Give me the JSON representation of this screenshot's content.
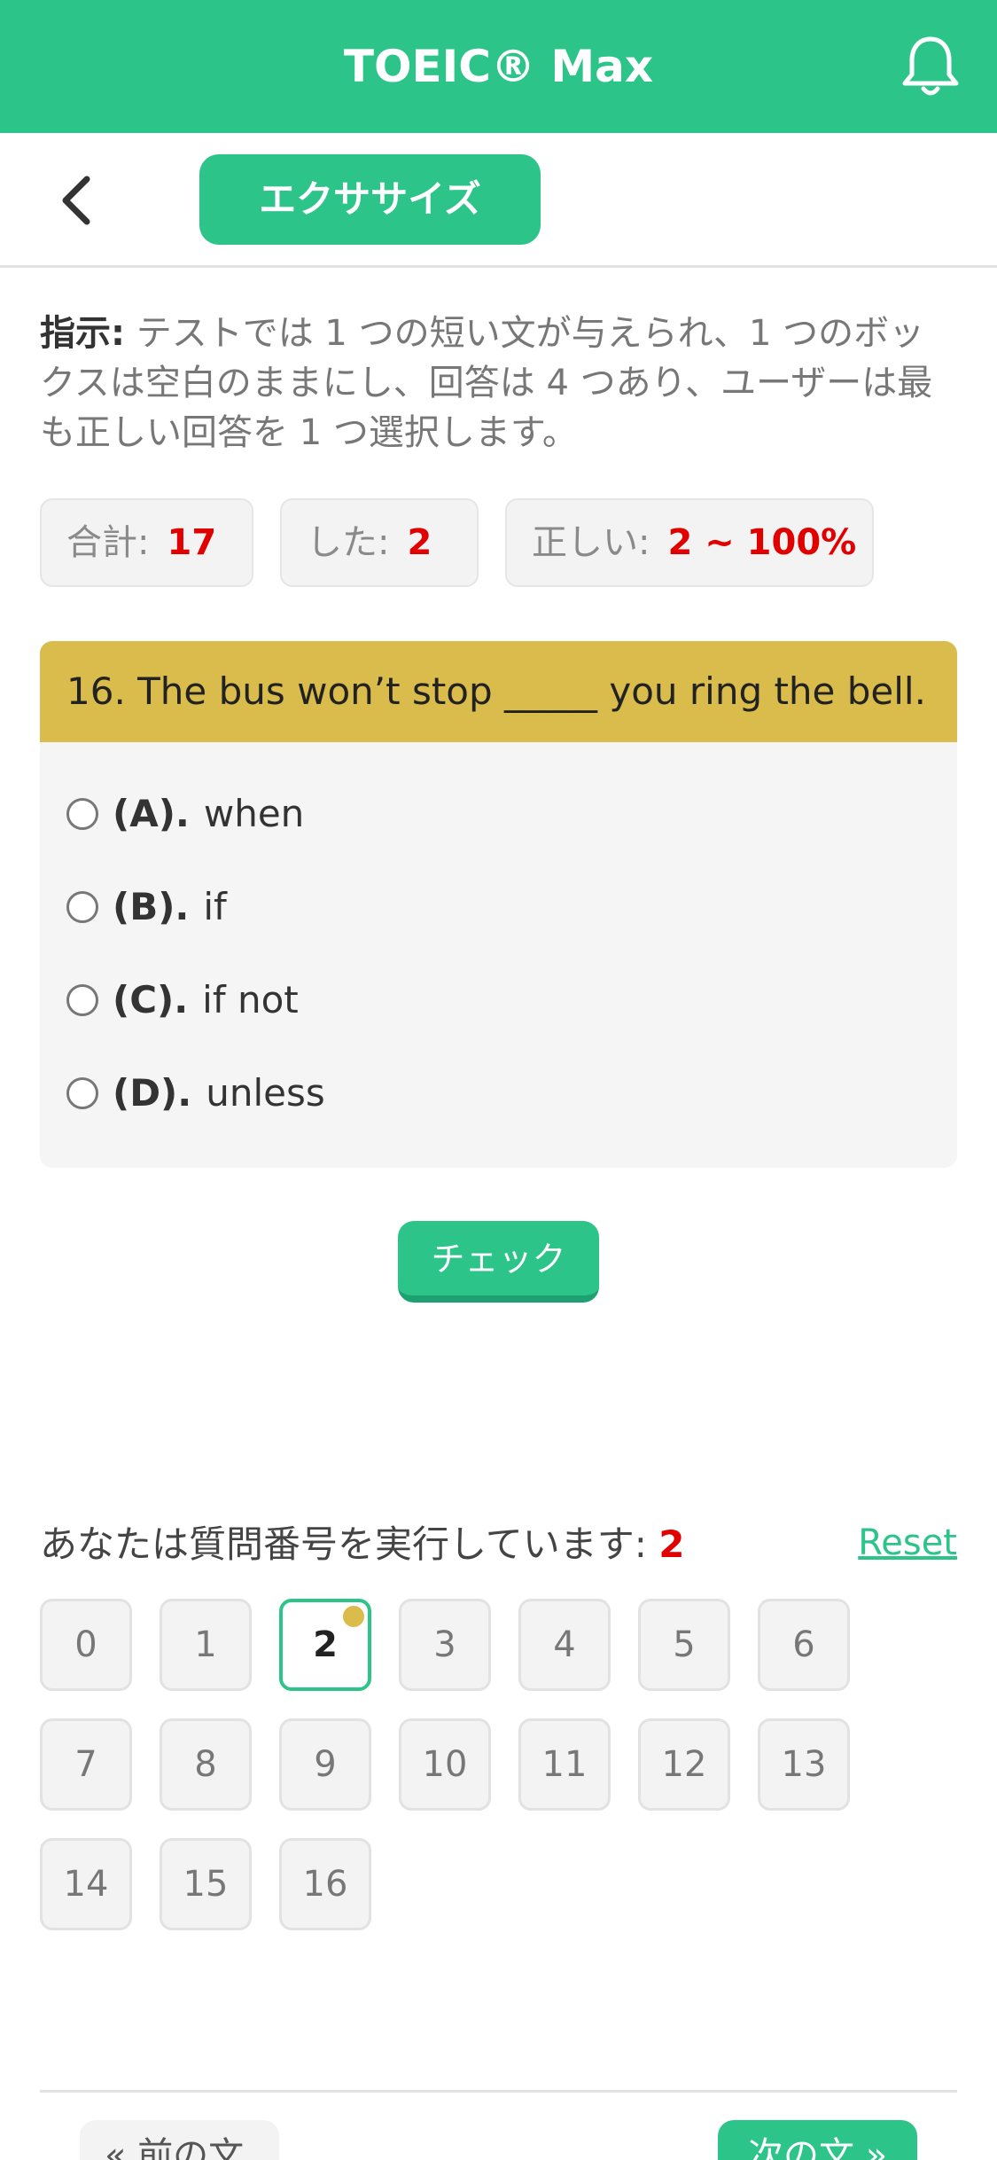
{
  "header": {
    "title": "TOEIC® Max",
    "bell_icon": "bell-icon",
    "background": "#2dc48a"
  },
  "subbar": {
    "back_icon": "chevron-left-icon",
    "exercise_label": "エクササイズ"
  },
  "instruction": {
    "label": "指示:",
    "text": " テストでは 1 つの短い文が与えられ、1 つのボックスは空白のままにし、回答は 4 つあり、ユーザーは最も正しい回答を 1 つ選択します。"
  },
  "stats": {
    "total_label": "合計:",
    "total_value": "17",
    "done_label": "した:",
    "done_value": "2",
    "correct_label": "正しい:",
    "correct_value": "2 ~ 100%"
  },
  "question": {
    "text": "16. The bus won’t stop _____ you ring the bell.",
    "options": [
      {
        "letter": "(A).",
        "text": "when"
      },
      {
        "letter": "(B).",
        "text": "if"
      },
      {
        "letter": "(C).",
        "text": "if not"
      },
      {
        "letter": "(D).",
        "text": "unless"
      }
    ]
  },
  "check_label": "チェック",
  "progress": {
    "label": "あなたは質問番号を実行しています:",
    "current": "2",
    "reset_label": "Reset",
    "numbers": [
      "0",
      "1",
      "2",
      "3",
      "4",
      "5",
      "6",
      "7",
      "8",
      "9",
      "10",
      "11",
      "12",
      "13",
      "14",
      "15",
      "16"
    ],
    "active_index": 2
  },
  "footer": {
    "prev_label": "« 前の文",
    "next_label": "次の文 »"
  },
  "colors": {
    "accent": "#2dc48a",
    "question_bar": "#d9bc4c",
    "value_red": "#e00000"
  }
}
